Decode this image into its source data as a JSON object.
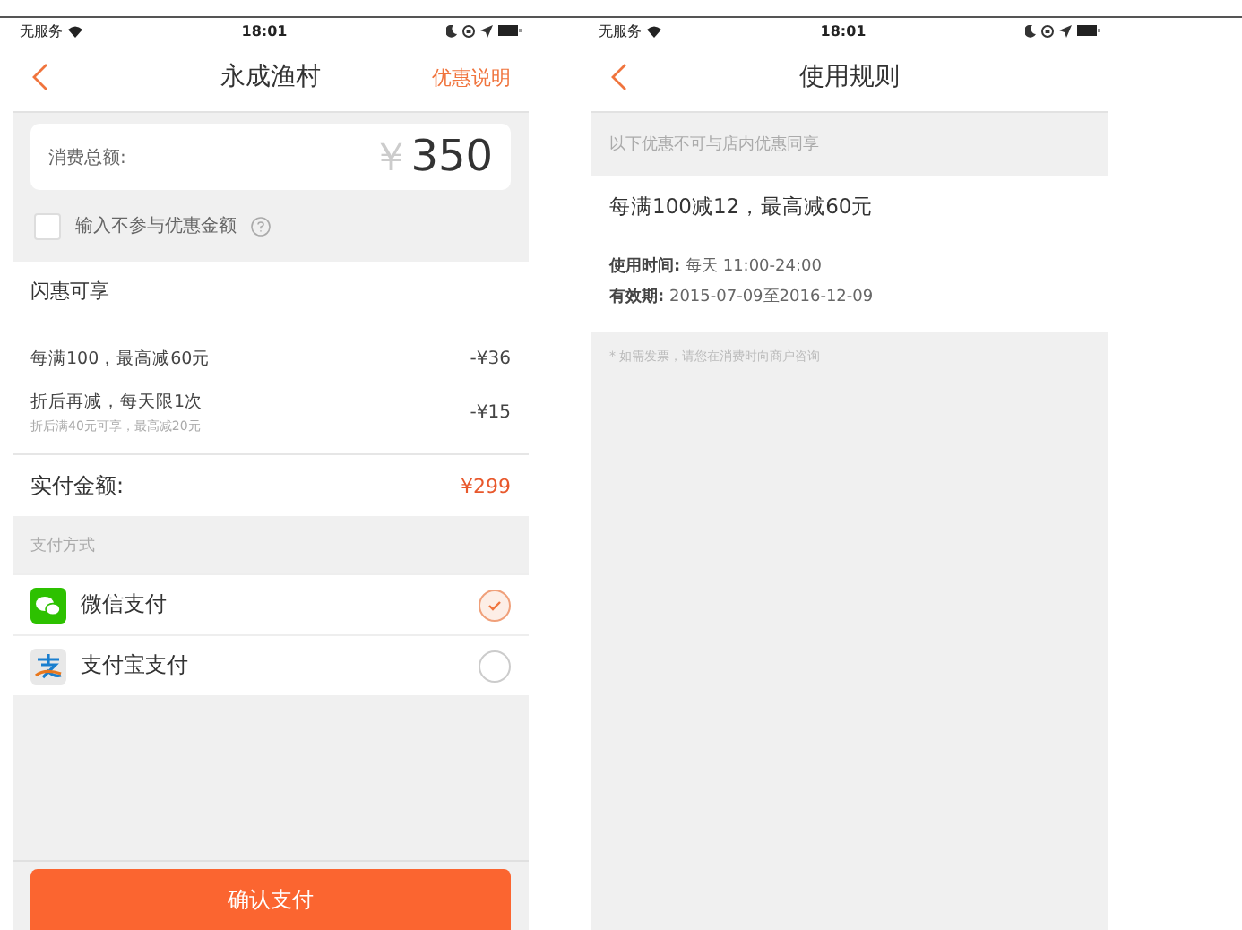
{
  "screens": [
    {
      "status_bar": {
        "carrier": "无服务",
        "time": "18:01"
      },
      "nav": {
        "title": "永成渔村",
        "action": "优惠说明"
      },
      "amount": {
        "label": "消费总额:",
        "currency": "￥",
        "value": "350"
      },
      "exclude_option": {
        "label": "输入不参与优惠金额",
        "checked": false
      },
      "discounts": {
        "title": "闪惠可享",
        "items": [
          {
            "title": "每满100，最高减60元",
            "amount": "-¥36"
          },
          {
            "title": "折后再减，每天限1次",
            "note": "折后满40元可享，最高减20元",
            "amount": "-¥15"
          }
        ]
      },
      "total": {
        "label": "实付金额:",
        "value": "¥299"
      },
      "payment": {
        "title": "支付方式",
        "methods": [
          {
            "kind": "wechat",
            "label": "微信支付",
            "selected": true
          },
          {
            "kind": "alipay",
            "label": "支付宝支付",
            "selected": false
          }
        ]
      },
      "confirm_button": "确认支付"
    },
    {
      "status_bar": {
        "carrier": "无服务",
        "time": "18:01"
      },
      "nav": {
        "title": "使用规则"
      },
      "notice": "以下优惠不可与店内优惠同享",
      "rule": {
        "title": "每满100减12，最高减60元",
        "details": [
          {
            "label": "使用时间:",
            "value": "每天 11:00-24:00"
          },
          {
            "label": "有效期:",
            "value": "2015-07-09至2016-12-09"
          }
        ]
      },
      "footnote": "* 如需发票，请您在消费时向商户咨询"
    }
  ]
}
